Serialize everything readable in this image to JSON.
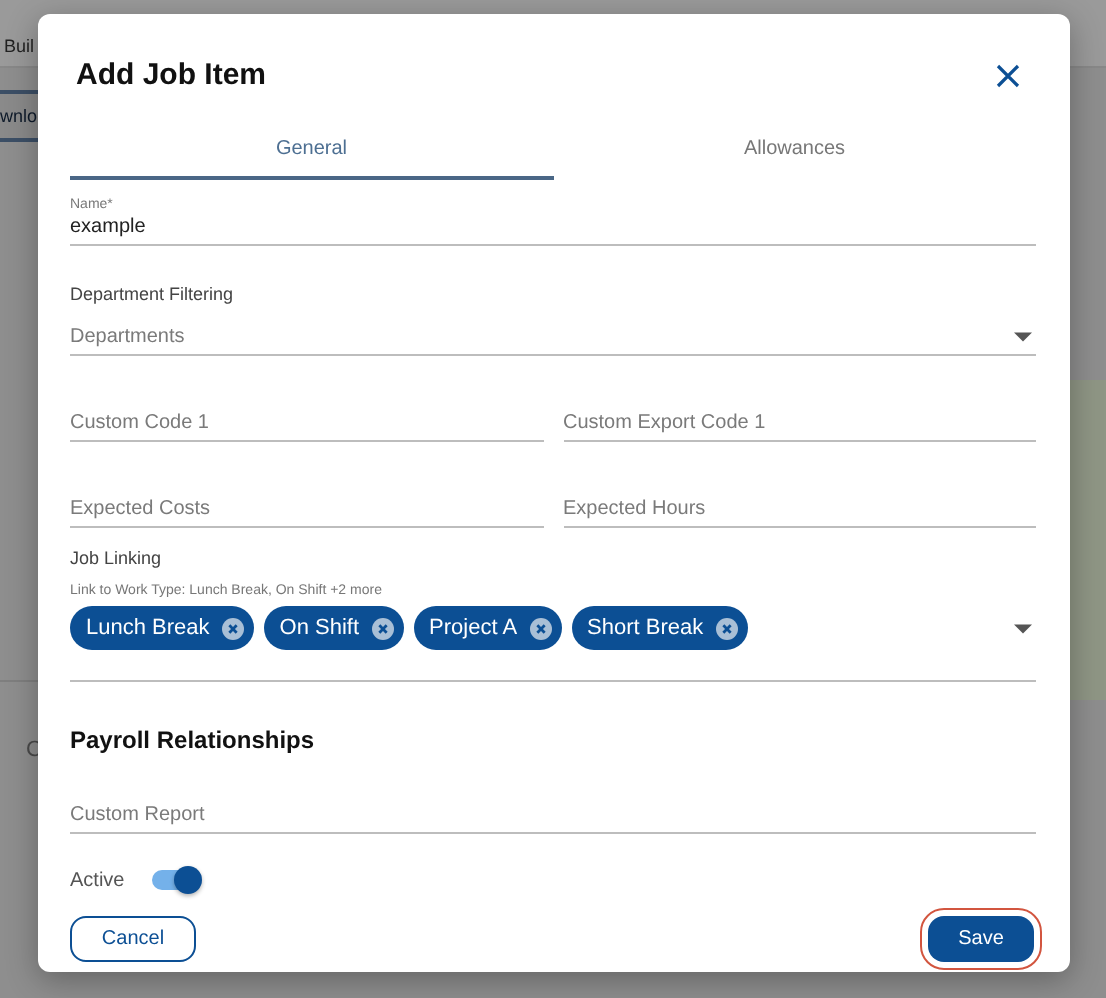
{
  "background": {
    "texts": [
      "Buil",
      "wnlo",
      "C"
    ]
  },
  "dialog": {
    "title": "Add Job Item",
    "tabs": [
      {
        "label": "General",
        "selected": true
      },
      {
        "label": "Allowances",
        "selected": false
      }
    ],
    "name_field": {
      "label": "Name*",
      "value": "example"
    },
    "department_filtering": {
      "label": "Department Filtering",
      "placeholder": "Departments"
    },
    "custom_fields": [
      {
        "placeholder": "Custom Code 1"
      },
      {
        "placeholder": "Custom Export Code 1"
      },
      {
        "placeholder": "Expected Costs"
      },
      {
        "placeholder": "Expected Hours"
      }
    ],
    "job_linking": {
      "label": "Job Linking",
      "hint": "Link to Work Type: Lunch Break, On Shift +2 more",
      "chips": [
        "Lunch Break",
        "On Shift",
        "Project A",
        "Short Break"
      ]
    },
    "payroll": {
      "heading": "Payroll Relationships",
      "custom_report": {
        "placeholder": "Custom Report"
      }
    },
    "active": {
      "label": "Active",
      "on": true
    },
    "buttons": [
      {
        "label": "Cancel",
        "kind": "outlined",
        "highlighted": false
      },
      {
        "label": "Save",
        "kind": "filled",
        "highlighted": true
      }
    ]
  }
}
